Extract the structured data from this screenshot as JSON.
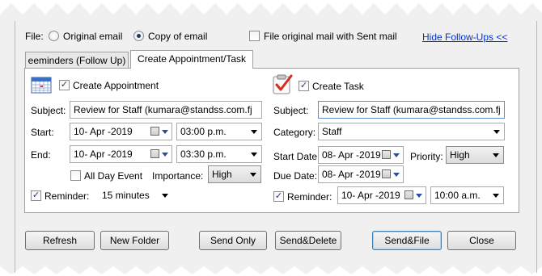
{
  "file_row": {
    "label": "File:",
    "option_original": "Original email",
    "option_copy": "Copy of email",
    "selected": "Copy of email",
    "file_sent_label": "File original mail with Sent mail",
    "file_sent_checked": false,
    "hide_followups_link": "Hide Follow-Ups <<"
  },
  "tabs": [
    {
      "label": "eeminders (Follow Up)",
      "active": false
    },
    {
      "label": "Create Appointment/Task",
      "active": true
    }
  ],
  "appointment": {
    "create_label": "Create Appointment",
    "create_checked": true,
    "subject_label": "Subject:",
    "subject_value": "Review for Staff (kumara@standss.com.fj",
    "start_label": "Start:",
    "start_date": "10- Apr -2019",
    "start_time": "03:00 p.m.",
    "end_label": "End:",
    "end_date": "10- Apr -2019",
    "end_time": "03:30 p.m.",
    "all_day_label": "All Day Event",
    "all_day_checked": false,
    "importance_label": "Importance:",
    "importance_value": "High",
    "reminder_label": "Reminder:",
    "reminder_checked": true,
    "reminder_value": "15 minutes"
  },
  "task": {
    "create_label": "Create Task",
    "create_checked": true,
    "subject_label": "Subject:",
    "subject_value": "Review for Staff (kumara@standss.com.fj",
    "category_label": "Category:",
    "category_value": "Staff",
    "start_date_label": "Start Date:",
    "start_date": "08- Apr -2019",
    "priority_label": "Priority:",
    "priority_value": "High",
    "due_date_label": "Due Date:",
    "due_date": "08- Apr -2019",
    "reminder_label": "Reminder:",
    "reminder_checked": true,
    "reminder_date": "10- Apr -2019",
    "reminder_time": "10:00 a.m."
  },
  "buttons": {
    "refresh": "Refresh",
    "new_folder": "New Folder",
    "send_only": "Send Only",
    "send_delete": "Send&Delete",
    "send_file": "Send&File",
    "close": "Close"
  },
  "colors": {
    "link": "#0033cc",
    "panel_bg": "#f0f0f0",
    "checkmark": "#213b74"
  },
  "icons": {
    "appointment": "calendar-icon",
    "task": "task-checklist-icon"
  }
}
